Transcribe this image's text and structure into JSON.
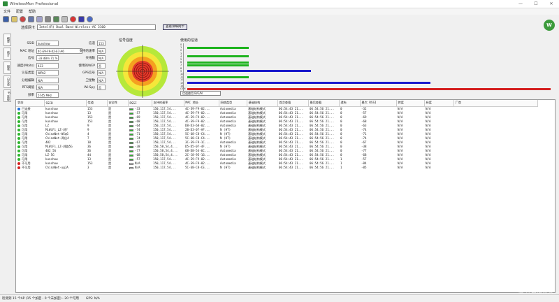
{
  "window": {
    "title": "WirelessMon Professional"
  },
  "menu": [
    "文件",
    "配置",
    "帮助"
  ],
  "adapter": {
    "label": "选择网卡",
    "value": "Intel(R) Dual Band Wireless-AC 3160",
    "button": "查看详细网卡"
  },
  "logo_text": "W",
  "sidetabs": [
    "概要",
    "统计",
    "图表",
    "白名单",
    "IP 连接"
  ],
  "info": [
    {
      "k": "SSID",
      "v": "kunshow"
    },
    {
      "k": "MAC 地址",
      "v": "4C-E9-F9-02-E7-A6"
    },
    {
      "k": "信号",
      "v": "-33 dBm    71 %"
    },
    {
      "k": "速度(Mbits)",
      "v": "433"
    },
    {
      "k": "认证类型",
      "v": "WPA2"
    },
    {
      "k": "分组编辑",
      "v": "N/A"
    },
    {
      "k": "RTS阈值",
      "v": "N/A"
    },
    {
      "k": "频率",
      "v": "5745 MHz"
    }
  ],
  "info2": [
    {
      "k": "信道",
      "v": "153"
    },
    {
      "k": "支持的速率",
      "v": "N/A"
    },
    {
      "k": "天线数",
      "v": "N/A"
    },
    {
      "k": "使用的WEP",
      "v": "否"
    },
    {
      "k": "GPS信号",
      "v": "N/A"
    },
    {
      "k": "卫星数",
      "v": "N/A"
    },
    {
      "k": "Wi-Spy",
      "v": "否"
    }
  ],
  "signal_title": "信号强度",
  "channel_title": "使用的信道",
  "channel_select": "信道使用 B/G/N",
  "channel_ticks": [
    "0",
    "1",
    "2",
    "3",
    "4",
    "5",
    "6",
    "7",
    "8",
    "9",
    "10",
    "11",
    "12",
    "13",
    "14",
    "OTH"
  ],
  "channel_usage": [
    {
      "channel": "1",
      "fraction": 0.17,
      "color": "#1db31d"
    },
    {
      "channel": "4",
      "fraction": 0.17,
      "color": "#1db31d"
    },
    {
      "channel": "6",
      "fraction": 0.17,
      "color": "#1db31d"
    },
    {
      "channel": "7",
      "fraction": 0.17,
      "color": "#1db31d"
    },
    {
      "channel": "9",
      "fraction": 0.34,
      "color": "#1a1acc"
    },
    {
      "channel": "11",
      "fraction": 0.17,
      "color": "#1db31d"
    },
    {
      "channel": "13",
      "fraction": 0.67,
      "color": "#1a1acc"
    },
    {
      "channel": "OTH",
      "fraction": 1.0,
      "color": "#d42020"
    }
  ],
  "columns": [
    "状态",
    "SSID",
    "信道",
    "安全性",
    "RSSI",
    "支持的速率",
    "MAC 地址",
    "网络类型",
    "基础结构",
    "首次查看",
    "最后查看",
    "遗失",
    "最大 RSSI",
    "跨度",
    "经度",
    "厂商"
  ],
  "rows": [
    [
      "已连接",
      "kunshow",
      "153",
      "是",
      "-33",
      "150,117,54...",
      "4C-E9-F9-02...",
      "Automedia",
      "基础结构模式",
      "06:54:43 21...",
      "06:54:56 21...",
      "0",
      "-32",
      "N/A",
      "N/A",
      ""
    ],
    [
      "可用",
      "kunshow",
      "13",
      "是",
      "-57",
      "150,117,54...",
      "4C-E9-F9-02...",
      "Automedia",
      "基础结构模式",
      "06:54:43 21...",
      "06:54:56 21...",
      "0",
      "-57",
      "N/A",
      "N/A",
      ""
    ],
    [
      "可用",
      "kunshow",
      "153",
      "是",
      "-69",
      "150,117,54...",
      "4C-E9-F9-02...",
      "Automedia",
      "基础结构模式",
      "06:54:43 21...",
      "06:54:56 21...",
      "0",
      "-69",
      "N/A",
      "N/A",
      ""
    ],
    [
      "可用",
      "kunshow",
      "153",
      "是",
      "-68",
      "150,117,54...",
      "4C-E9-F9-02...",
      "Automedia",
      "基础结构模式",
      "06:54:43 21...",
      "06:54:56 21...",
      "0",
      "-68",
      "N/A",
      "N/A",
      ""
    ],
    [
      "可用",
      "LZ",
      "9",
      "是",
      "-64",
      "150,117,54...",
      "D8-D3-68-02...",
      "Automedia",
      "基础结构模式",
      "06:54:43 21...",
      "06:54:56 21...",
      "0",
      "-63",
      "N/A",
      "N/A",
      ""
    ],
    [
      "可用",
      "MiWiFi_LZ-鸿?",
      "9",
      "是",
      "-74",
      "150,117,54...",
      "28-D3-07-AF...",
      "N (HT)",
      "基础结构模式",
      "06:54:43 21...",
      "06:54:56 21...",
      "0",
      "-74",
      "N/A",
      "N/A",
      ""
    ],
    [
      "可用",
      "ChinaNet-WXq6",
      "4",
      "是",
      "-71",
      "150,117,54...",
      "5C-68-C8-C4...",
      "N (HT)",
      "基础结构模式",
      "06:54:43 21...",
      "06:54:56 21...",
      "0",
      "-71",
      "N/A",
      "N/A",
      ""
    ],
    [
      "可用",
      "ChinaNet-两佳4",
      "7",
      "是",
      "-74",
      "150,117,54...",
      "5C-68-C8-C4...",
      "N (HT)",
      "基础结构模式",
      "06:54:43 21...",
      "06:54:56 21...",
      "0",
      "-74",
      "N/A",
      "N/A",
      ""
    ],
    [
      "可用",
      "402",
      "10",
      "是",
      "-67",
      "150,117,54...",
      "3C-E9-F9-1C...",
      "Automedia",
      "基础结构模式",
      "06:54:43 21...",
      "06:54:56 21...",
      "0",
      "-67",
      "N/A",
      "N/A",
      ""
    ],
    [
      "可用",
      "MiWiFi_LZ-鸿路5G",
      "36",
      "是",
      "-38",
      "150,58,54,4...",
      "D5-D5-07-4F...",
      "N (HT)",
      "基础结构模式",
      "06:54:43 21...",
      "06:54:56 21...",
      "0",
      "-38",
      "N/A",
      "N/A",
      ""
    ],
    [
      "可用",
      "402_5G",
      "36",
      "是",
      "-77",
      "150,58,54,4...",
      "68-D8-54-6C...",
      "Automedia",
      "基础结构模式",
      "06:54:43 21...",
      "06:54:56 21...",
      "0",
      "-77",
      "N/A",
      "N/A",
      ""
    ],
    [
      "可用",
      "LZ-5G",
      "44",
      "是",
      "-68",
      "150,58,54,4...",
      "2C-C8-9E-16...",
      "Automedia",
      "基础结构模式",
      "06:54:43 21...",
      "06:54:56 21...",
      "0",
      "-68",
      "N/A",
      "N/A",
      ""
    ],
    [
      "可用",
      "kunshow",
      "13",
      "是",
      "-57",
      "150,117,54...",
      "4C-E9-F9-02...",
      "Automedia",
      "基础结构模式",
      "06:54:43 21...",
      "06:54:56 21...",
      "1",
      "-57",
      "N/A",
      "N/A",
      ""
    ],
    [
      "不可用",
      "kunshow",
      "153",
      "是",
      "N/A",
      "150,117,54...",
      "4C-E9-F9-02...",
      "Automedia",
      "基础结构模式",
      "06:54:43 21...",
      "06:54:56 21...",
      "1",
      "-84",
      "N/A",
      "N/A",
      ""
    ],
    [
      "不可用",
      "ChinaNet-ugJA",
      "3",
      "是",
      "N/A",
      "150,117,54...",
      "5C-68-C8-CE...",
      "N (HT)",
      "基础结构模式",
      "06:54:43 21...",
      "06:54:56 21...",
      "1",
      "-85",
      "N/A",
      "N/A",
      ""
    ]
  ],
  "status_colors": {
    "已连接": "#1e6fd9",
    "可用": "#2db52d",
    "不可用": "#d42020"
  },
  "statusbar": [
    "检测到 15 个AP (15 个加密 - 0 个未加密) - 20 个可用",
    "GPS: N/A"
  ],
  "watermark": "值 什么值得买"
}
